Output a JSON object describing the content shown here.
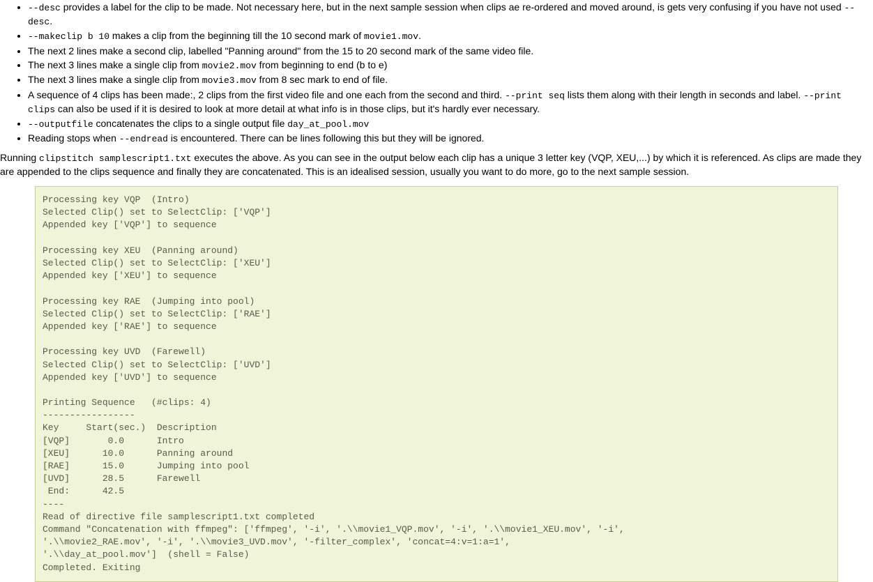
{
  "bullets": [
    {
      "parts": [
        {
          "type": "code",
          "text": "--desc"
        },
        {
          "type": "text",
          "text": " provides a label for the clip to be made. Not necessary here, but in the next sample session when clips ae re-ordered and moved around, is gets very confusing if you have not used "
        },
        {
          "type": "code",
          "text": "--desc"
        },
        {
          "type": "text",
          "text": "."
        }
      ]
    },
    {
      "parts": [
        {
          "type": "code",
          "text": "--makeclip b 10"
        },
        {
          "type": "text",
          "text": " makes a clip from the beginning till the 10 second mark of "
        },
        {
          "type": "code",
          "text": "movie1.mov"
        },
        {
          "type": "text",
          "text": "."
        }
      ]
    },
    {
      "parts": [
        {
          "type": "text",
          "text": "The next 2 lines make a second clip, labelled \"Panning around\" from the 15 to 20 second mark of the same video file."
        }
      ]
    },
    {
      "parts": [
        {
          "type": "text",
          "text": "The next 3 lines make a single clip from "
        },
        {
          "type": "code",
          "text": "movie2.mov"
        },
        {
          "type": "text",
          "text": " from beginning to end (b to e)"
        }
      ]
    },
    {
      "parts": [
        {
          "type": "text",
          "text": "The next 3 lines make a single clip from "
        },
        {
          "type": "code",
          "text": "movie3.mov"
        },
        {
          "type": "text",
          "text": " from 8 sec mark to end of file."
        }
      ]
    },
    {
      "parts": [
        {
          "type": "text",
          "text": "A sequence of 4 clips has been made:, 2 clips from the first video file and one each from the second and third. "
        },
        {
          "type": "code",
          "text": "--print seq"
        },
        {
          "type": "text",
          "text": " lists them along with their length in seconds and label. "
        },
        {
          "type": "code",
          "text": "--print clips"
        },
        {
          "type": "text",
          "text": " can also be used if it is desired to look at more detail at what info is in those clips, but it's hardly ever necessary."
        }
      ]
    },
    {
      "parts": [
        {
          "type": "code",
          "text": "--outputfile"
        },
        {
          "type": "text",
          "text": " concatenates the clips to a single output file "
        },
        {
          "type": "code",
          "text": "day_at_pool.mov"
        }
      ]
    },
    {
      "parts": [
        {
          "type": "text",
          "text": "Reading stops when "
        },
        {
          "type": "code",
          "text": "--endread"
        },
        {
          "type": "text",
          "text": " is encountered. There can be lines following this but they will be ignored."
        }
      ]
    }
  ],
  "para": {
    "parts": [
      {
        "type": "text",
        "text": "Running "
      },
      {
        "type": "code",
        "text": "clipstitch samplescript1.txt"
      },
      {
        "type": "text",
        "text": " executes the above. As you can see in the output below each clip has a unique 3 letter key (VQP, XEU,...) by which it is referenced. As clips are made they are appended to the clips sequence and finally they are concatenated. This is an idealised session, usually you want to do more, go to the next sample session."
      }
    ]
  },
  "preformatted": "Processing key VQP  (Intro)\nSelected Clip() set to SelectClip: ['VQP']\nAppended key ['VQP'] to sequence\n\nProcessing key XEU  (Panning around)\nSelected Clip() set to SelectClip: ['XEU']\nAppended key ['XEU'] to sequence\n\nProcessing key RAE  (Jumping into pool)\nSelected Clip() set to SelectClip: ['RAE']\nAppended key ['RAE'] to sequence\n\nProcessing key UVD  (Farewell)\nSelected Clip() set to SelectClip: ['UVD']\nAppended key ['UVD'] to sequence\n\nPrinting Sequence   (#clips: 4)\n-----------------\nKey     Start(sec.)  Description\n[VQP]       0.0      Intro\n[XEU]      10.0      Panning around\n[RAE]      15.0      Jumping into pool\n[UVD]      28.5      Farewell\n End:      42.5\n----\nRead of directive file samplescript1.txt completed\nCommand \"Concatenation with ffmpeg\": ['ffmpeg', '-i', '.\\\\movie1_VQP.mov', '-i', '.\\\\movie1_XEU.mov', '-i',\n'.\\\\movie2_RAE.mov', '-i', '.\\\\movie3_UVD.mov', '-filter_complex', 'concat=4:v=1:a=1',\n'.\\\\day_at_pool.mov']  (shell = False)\nCompleted. Exiting"
}
